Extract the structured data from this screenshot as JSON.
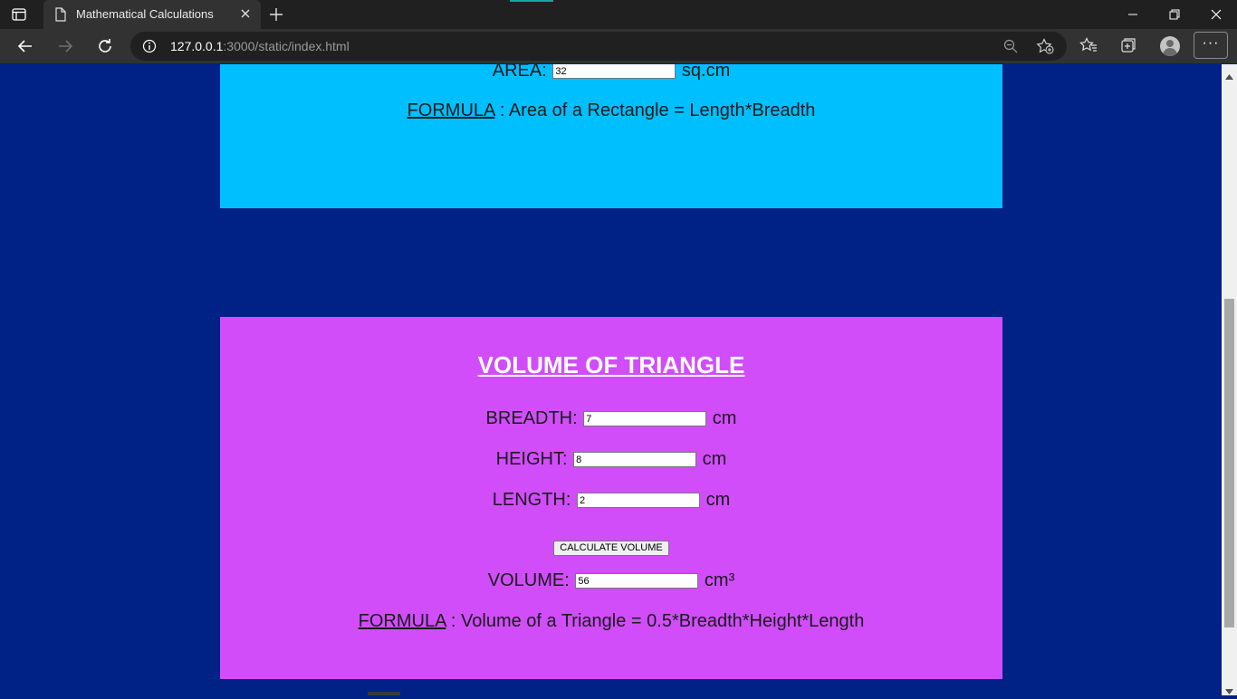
{
  "browser": {
    "tab_title": "Mathematical Calculations",
    "url_host": "127.0.0.1",
    "url_rest": ":3000/static/index.html",
    "more_label": "···"
  },
  "area_section": {
    "area_label": "AREA:",
    "area_value": "32",
    "area_unit": "sq.cm",
    "formula_link": "FORMULA",
    "formula_text": " : Area of a Rectangle = Length*Breadth"
  },
  "volume_section": {
    "title": "VOLUME OF TRIANGLE",
    "breadth_label": "BREADTH:",
    "breadth_value": "7",
    "breadth_unit": "cm",
    "height_label": "HEIGHT:",
    "height_value": "8",
    "height_unit": "cm",
    "length_label": "LENGTH:",
    "length_value": "2",
    "length_unit": "cm",
    "calculate_label": "CALCULATE VOLUME",
    "volume_label": "VOLUME:",
    "volume_value": "56",
    "volume_unit": "cm³",
    "formula_link": "FORMULA",
    "formula_text": " : Volume of a Triangle = 0.5*Breadth*Height*Length"
  },
  "colors": {
    "page_background": "#002185",
    "area_panel": "#00bfff",
    "volume_panel": "#d14dfa"
  }
}
